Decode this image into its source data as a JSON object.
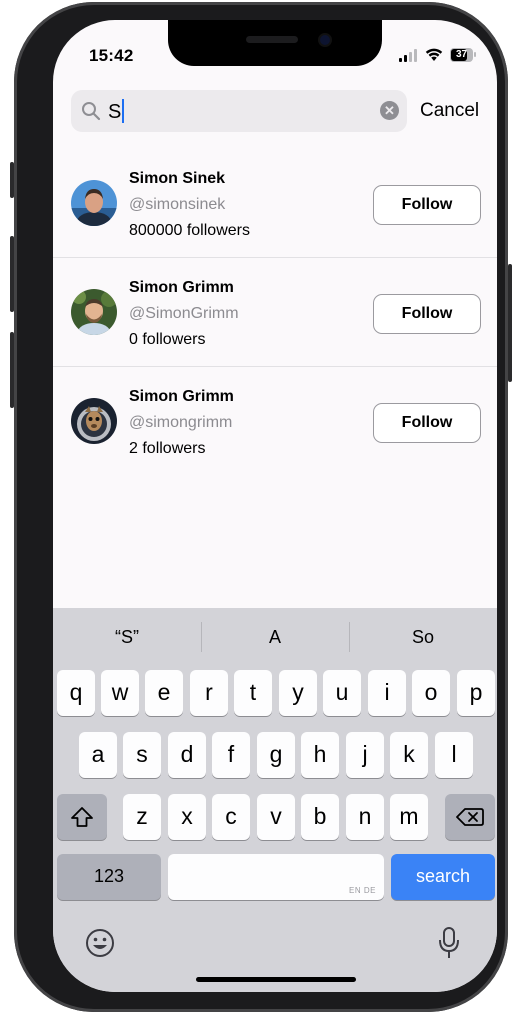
{
  "status_bar": {
    "time": "15:42",
    "battery": "37"
  },
  "search": {
    "query": "S",
    "cancel_label": "Cancel"
  },
  "results": [
    {
      "name": "Simon Sinek",
      "handle": "@simonsinek",
      "followers": "800000 followers",
      "follow_label": "Follow"
    },
    {
      "name": "Simon Grimm",
      "handle": "@SimonGrimm",
      "followers": "0 followers",
      "follow_label": "Follow"
    },
    {
      "name": "Simon Grimm",
      "handle": "@simongrimm",
      "followers": "2 followers",
      "follow_label": "Follow"
    }
  ],
  "keyboard": {
    "suggestions": [
      "“S”",
      "A",
      "So"
    ],
    "row1": [
      "q",
      "w",
      "e",
      "r",
      "t",
      "y",
      "u",
      "i",
      "o",
      "p"
    ],
    "row2": [
      "a",
      "s",
      "d",
      "f",
      "g",
      "h",
      "j",
      "k",
      "l"
    ],
    "row3": [
      "z",
      "x",
      "c",
      "v",
      "b",
      "n",
      "m"
    ],
    "numbers_label": "123",
    "space_hint": "EN DE",
    "action_label": "search"
  },
  "colors": {
    "accent": "#3a83f6",
    "caret": "#1c6ef2",
    "screen_bg": "#fbf9fb",
    "keyboard_bg": "#d3d3d8"
  },
  "icons": [
    "search-icon",
    "clear-icon",
    "shift-icon",
    "backspace-icon",
    "emoji-icon",
    "microphone-icon",
    "signal-icon",
    "wifi-icon",
    "battery-icon"
  ]
}
